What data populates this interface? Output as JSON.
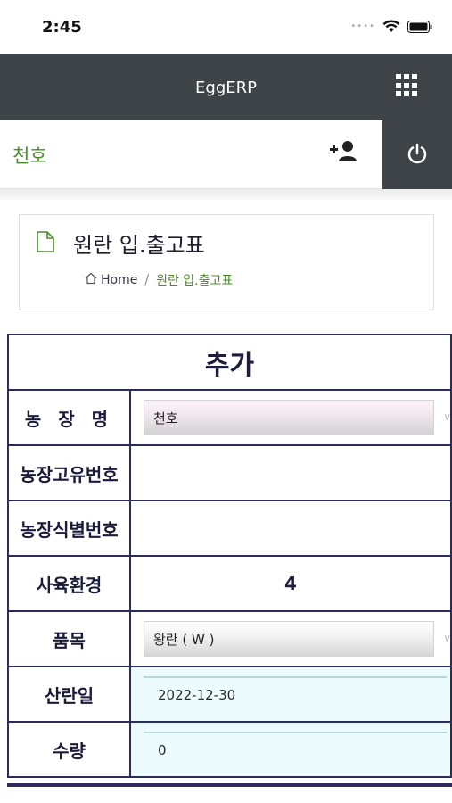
{
  "status_bar": {
    "time": "2:45"
  },
  "header": {
    "app_title": "EggERP"
  },
  "user_bar": {
    "user_name": "천호"
  },
  "page": {
    "title": "원란 입.출고표",
    "breadcrumb": {
      "home": "Home",
      "separator": "/",
      "current": "원란 입.출고표"
    }
  },
  "form": {
    "header": "추가",
    "rows": [
      {
        "label": "농 장 명",
        "type": "select",
        "value": "천호"
      },
      {
        "label": "농장고유번호",
        "type": "text",
        "value": ""
      },
      {
        "label": "농장식별번호",
        "type": "text",
        "value": ""
      },
      {
        "label": "사육환경",
        "type": "text",
        "value": "4"
      },
      {
        "label": "품목",
        "type": "select",
        "value": "왕란 ( W )"
      },
      {
        "label": "산란일",
        "type": "input",
        "value": "2022-12-30"
      },
      {
        "label": "수량",
        "type": "input",
        "value": "0"
      }
    ]
  },
  "colors": {
    "header_bg": "#3f4449",
    "accent_green": "#4e8b2f",
    "table_border": "#2b2b5c",
    "input_bg": "#ecfbfd"
  }
}
